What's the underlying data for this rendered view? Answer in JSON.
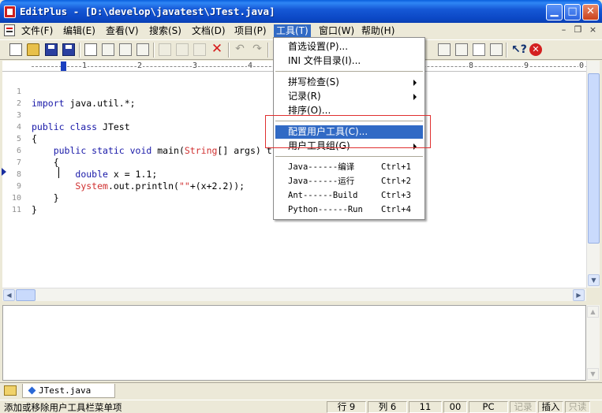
{
  "window": {
    "title": "EditPlus - [D:\\develop\\javatest\\JTest.java]"
  },
  "menubar": {
    "items": [
      "文件(F)",
      "编辑(E)",
      "查看(V)",
      "搜索(S)",
      "文档(D)",
      "项目(P)",
      "工具(T)",
      "窗口(W)",
      "帮助(H)"
    ]
  },
  "ruler": {
    "marks": [
      "1",
      "2",
      "3",
      "4",
      "5",
      "6",
      "7",
      "8",
      "9",
      "0"
    ]
  },
  "editor": {
    "line_numbers": [
      "1",
      "2",
      "3",
      "4",
      "5",
      "6",
      "7",
      "8",
      "9",
      "10",
      "11"
    ],
    "lines": [
      {
        "kw": "import",
        "rest": " java.util.*;"
      },
      {
        "kw": "",
        "rest": ""
      },
      {
        "kw": "public class",
        "rest": " JTest"
      },
      {
        "kw": "",
        "rest": "{"
      },
      {
        "indent": "    ",
        "kw": "public static void",
        "mid": " main(",
        "ty": "String",
        "rest": "[] args) t"
      },
      {
        "indent": "    ",
        "kw": "",
        "rest": "{"
      },
      {
        "indent": "        ",
        "kw": "double",
        "rest": " x = 1.1;"
      },
      {
        "indent": "        ",
        "ty": "System",
        "rest": ".out.println(",
        "str": "\"\"",
        "tail": "+(x+2.2));"
      },
      {
        "indent": "    ",
        "kw": "",
        "rest": "}"
      },
      {
        "kw": "",
        "rest": "}"
      },
      {
        "kw": "",
        "rest": ""
      }
    ]
  },
  "tools_menu": {
    "items": [
      {
        "label": "首选设置(P)...",
        "arrow": false
      },
      {
        "label": "INI 文件目录(I)...",
        "arrow": false
      },
      {
        "label": "拼写检查(S)",
        "arrow": true
      },
      {
        "label": "记录(R)",
        "arrow": true
      },
      {
        "label": "排序(O)...",
        "arrow": false
      },
      {
        "label": "配置用户工具(C)...",
        "arrow": false,
        "highlighted": true
      },
      {
        "label": "用户工具组(G)",
        "arrow": true
      },
      {
        "label": "Java------编译",
        "shortcut": "Ctrl+1"
      },
      {
        "label": "Java------运行",
        "shortcut": "Ctrl+2"
      },
      {
        "label": "Ant------Build",
        "shortcut": "Ctrl+3"
      },
      {
        "label": "Python------Run",
        "shortcut": "Ctrl+4"
      }
    ]
  },
  "doc_tabs": [
    {
      "label": "JTest.java"
    }
  ],
  "statusbar": {
    "message": "添加或移除用户工具栏菜单项",
    "row": "行 9",
    "col": "列 6",
    "c1": "11",
    "c2": "00",
    "encoding": "PC",
    "record": "记录",
    "insert": "插入",
    "readonly": "只读"
  },
  "colors": {
    "accent": "#316ac5",
    "highlight_box": "#e03030",
    "keyword": "#1818a8",
    "type": "#d03030"
  }
}
